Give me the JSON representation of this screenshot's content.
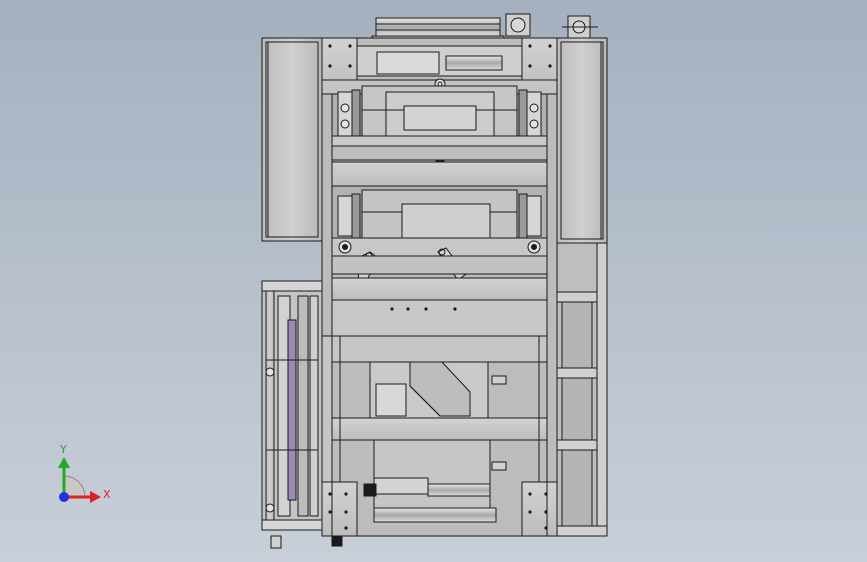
{
  "viewport": {
    "background_top": "#a5b0bf",
    "background_bottom": "#c8cfd9"
  },
  "model": {
    "line_color": "#1a1a1a",
    "fill_light": "#c9c9c9",
    "fill_mid": "#b4b4b4",
    "fill_dark": "#8f8f8f",
    "accent_purple": "#9a8cb5"
  },
  "triad": {
    "y_label": "Y",
    "x_label": "X",
    "y_color": "#22aa22",
    "x_color": "#dd2222",
    "z_color": "#2233dd"
  }
}
